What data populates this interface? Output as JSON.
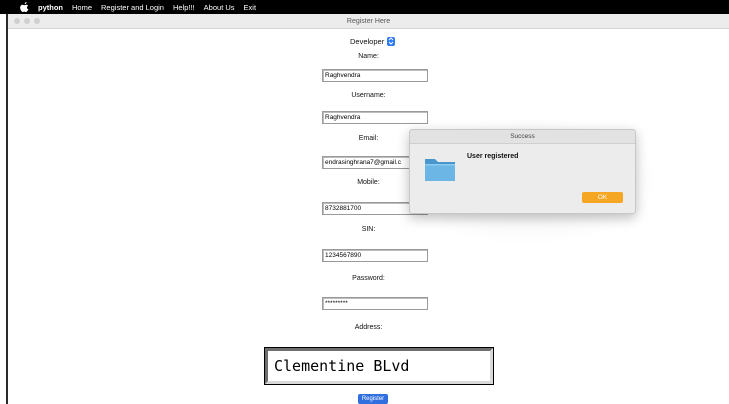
{
  "menubar": {
    "app_name": "python",
    "items": [
      "Home",
      "Register and Login",
      "Help!!!",
      "About Us",
      "Exit"
    ]
  },
  "window": {
    "title": "Register Here"
  },
  "form": {
    "role_select": {
      "value": "Developer"
    },
    "name": {
      "label": "Name:",
      "value": "Raghvendra"
    },
    "username": {
      "label": "Username:",
      "value": "Raghvendra"
    },
    "email": {
      "label": "Email:",
      "value": "endrasinghrana7@gmail.c"
    },
    "mobile": {
      "label": "Mobile:",
      "value": "8732881700"
    },
    "sin": {
      "label": "SIN:",
      "value": "1234567890"
    },
    "password": {
      "label": "Password:",
      "value": "*********"
    },
    "address": {
      "label": "Address:",
      "value": "Clementine BLvd"
    },
    "register_label": "Register"
  },
  "dialog": {
    "title": "Success",
    "message": "User registered",
    "ok_label": "OK",
    "icon": "folder-icon"
  },
  "colors": {
    "accent": "#2f6fe0",
    "ok_button": "#f5a623",
    "folder": "#5aa9dc"
  }
}
